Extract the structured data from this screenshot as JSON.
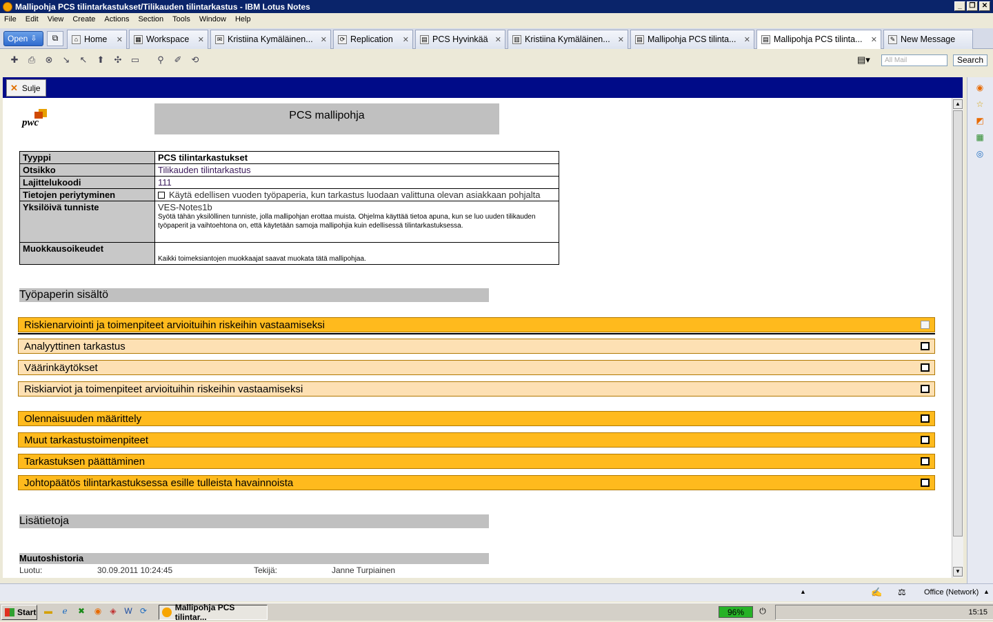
{
  "window": {
    "title": "Mallipohja PCS tilintarkastukset/Tilikauden tilintarkastus - IBM Lotus Notes"
  },
  "menu": [
    "File",
    "Edit",
    "View",
    "Create",
    "Actions",
    "Section",
    "Tools",
    "Window",
    "Help"
  ],
  "open_label": "Open",
  "tabs": [
    {
      "label": "Home"
    },
    {
      "label": "Workspace"
    },
    {
      "label": "Kristiina Kymäläinen..."
    },
    {
      "label": "Replication"
    },
    {
      "label": "PCS Hyvinkää"
    },
    {
      "label": "Kristiina Kymäläinen..."
    },
    {
      "label": "Mallipohja PCS tilinta..."
    },
    {
      "label": "Mallipohja PCS tilinta..."
    },
    {
      "label": "New Message"
    }
  ],
  "search": {
    "placeholder": "All Mail",
    "button": "Search"
  },
  "action": {
    "close_label": "Sulje"
  },
  "doc": {
    "logo_text": "pwc",
    "title": "PCS mallipohja",
    "props": {
      "type_label": "Tyyppi",
      "type_value": "PCS tilintarkastukset",
      "subject_label": "Otsikko",
      "subject_value": "Tilikauden tilintarkastus",
      "sort_label": "Lajittelukoodi",
      "sort_value": "111",
      "inherit_label": "Tietojen periytyminen",
      "inherit_value": "Käytä edellisen vuoden työpaperia, kun tarkastus luodaan valittuna olevan asiakkaan pohjalta",
      "id_label": "Yksilöivä tunniste",
      "id_value": "VES-Notes1b",
      "id_help": "Syötä tähän yksilöllinen tunniste, jolla mallipohjan erottaa muista. Ohjelma käyttää tietoa apuna, kun se luo uuden tilikauden työpaperit ja vaihtoehtona on, että käytetään samoja mallipohjia kuin edellisessä tilintarkastuksessa.",
      "edit_label": "Muokkausoikeudet",
      "edit_value": "Kaikki toimeksiantojen muokkaajat saavat muokata tätä mallipohjaa."
    },
    "content_header": "Työpaperin sisältö",
    "sections": [
      {
        "label": "Riskienarviointi ja toimenpiteet arvioituihin riskeihin vastaamiseksi"
      },
      {
        "label": "Analyyttinen tarkastus"
      },
      {
        "label": "Väärinkäytökset"
      },
      {
        "label": "Riskiarviot ja toimenpiteet arvioituihin riskeihin vastaamiseksi"
      },
      {
        "label": "Olennaisuuden määrittely"
      },
      {
        "label": "Muut tarkastustoimenpiteet"
      },
      {
        "label": "Tarkastuksen päättäminen"
      },
      {
        "label": "Johtopäätös tilintarkastuksessa esille tulleista havainnoista"
      }
    ],
    "extra_header": "Lisätietoja",
    "history_header": "Muutoshistoria",
    "created_label": "Luotu:",
    "created_value": "30.09.2011 10:24:45",
    "author_label": "Tekijä:",
    "author_value": "Janne Turpiainen"
  },
  "status": {
    "location": "Office (Network)"
  },
  "taskbar": {
    "start": "Start",
    "app": "Mallipohja PCS tilintar...",
    "battery": "96%",
    "clock": "15:15"
  }
}
